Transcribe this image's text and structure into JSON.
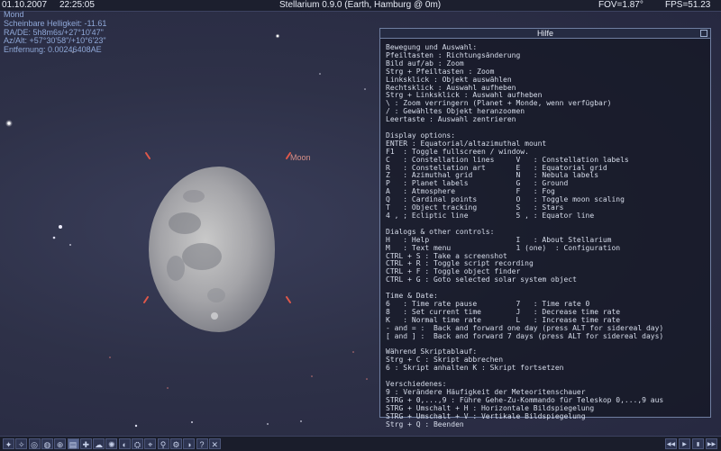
{
  "topbar": {
    "date": "01.10.2007",
    "time": "22:25:05",
    "title": "Stellarium 0.9.0 (Earth, Hamburg @ 0m)",
    "fov": "FOV=1.87°",
    "fps": "FPS=51.23"
  },
  "object_info": {
    "name": "Mond",
    "brightness": "Scheinbare Helligkeit: -11.61",
    "radec": "RA/DE:  5h8m6s/+27°10'47\"",
    "azalt": "Az/Alt: +57°30'58\"/+10°6'23\"",
    "distance": "Entfernung: 0.00246408AE"
  },
  "sky": {
    "moon_label": "Moon"
  },
  "help": {
    "title": "Hilfe",
    "lines": [
      "Bewegung und Auswahl:",
      "Pfeiltasten : Richtungsänderung",
      "Bild auf/ab : Zoom",
      "Strg + Pfeiltasten : Zoom",
      "Linksklick : Objekt auswählen",
      "Rechtsklick : Auswahl aufheben",
      "Strg + Linksklick : Auswahl aufheben",
      "\\ : Zoom verringern (Planet + Monde, wenn verfügbar)",
      "/ : Gewähltes Objekt heranzoomen",
      "Leertaste : Auswahl zentrieren",
      "",
      "Display options:",
      "ENTER : Equatorial/altazimuthal mount",
      "F1  : Toggle fullscreen / window.",
      "C   : Constellation lines     V   : Constellation labels",
      "R   : Constellation art       E   : Equatorial grid",
      "Z   : Azimuthal grid          N   : Nebula labels",
      "P   : Planet labels           G   : Ground",
      "A   : Atmosphere              F   : Fog",
      "Q   : Cardinal points         O   : Toggle moon scaling",
      "T   : Object tracking         S   : Stars",
      "4 , ; Ecliptic line           5 , : Equator line",
      "",
      "Dialogs & other controls:",
      "H   : Help                    I   : About Stellarium",
      "M   : Text menu               1 (one)  : Configuration",
      "CTRL + S : Take a screenshot",
      "CTRL + R : Toggle script recording",
      "CTRL + F : Toggle object finder",
      "CTRL + G : Goto selected solar system object",
      "",
      "Time & Date:",
      "6   : Time rate pause         7   : Time rate 0",
      "8   : Set current time        J   : Decrease time rate",
      "K   : Normal time rate        L   : Increase time rate",
      "- and = :  Back and forward one day (press ALT for sidereal day)",
      "[ and ] :  Back and forward 7 days (press ALT for sidereal days)",
      "",
      "Während Skriptablauf:",
      "Strg + C : Skript abbrechen",
      "6 : Skript anhalten K : Skript fortsetzen",
      "",
      "Verschiedenes:",
      "9 : Verändere Häufigkeit der Meteoritenschauer",
      "STRG + 0,...,9 : Führe Gehe-Zu-Kommando für Teleskop 0,...,9 aus",
      "STRG + Umschalt + H : Horizontale Bildspiegelung",
      "STRG + Umschalt + V : Vertikale Bildspiegelung",
      "Strg + Q : Beenden"
    ]
  },
  "toolbar": {
    "left_buttons": [
      {
        "name": "constellation-lines-icon",
        "glyph": "✦"
      },
      {
        "name": "constellation-labels-icon",
        "glyph": "✧"
      },
      {
        "name": "constellation-art-icon",
        "glyph": "◎"
      },
      {
        "name": "azimuthal-grid-icon",
        "glyph": "◍"
      },
      {
        "name": "equatorial-grid-icon",
        "glyph": "⊕"
      },
      {
        "name": "ground-icon",
        "glyph": "▤"
      },
      {
        "name": "cardinal-points-icon",
        "glyph": "✚"
      },
      {
        "name": "atmosphere-icon",
        "glyph": "☁"
      },
      {
        "name": "nebula-icon",
        "glyph": "✺"
      },
      {
        "name": "planet-labels-icon",
        "glyph": "◐"
      },
      {
        "name": "equatorial-mount-icon",
        "glyph": "⛭"
      },
      {
        "name": "center-selection-icon",
        "glyph": "⌖"
      },
      {
        "name": "search-icon",
        "glyph": "⚲"
      },
      {
        "name": "configuration-icon",
        "glyph": "⚙"
      },
      {
        "name": "night-mode-icon",
        "glyph": "◑"
      },
      {
        "name": "help-icon",
        "glyph": "?"
      },
      {
        "name": "quit-icon",
        "glyph": "✕"
      }
    ],
    "right_buttons": [
      {
        "name": "time-rewind-icon",
        "glyph": "◀◀"
      },
      {
        "name": "time-normal-icon",
        "glyph": "▶"
      },
      {
        "name": "time-now-icon",
        "glyph": "▮"
      },
      {
        "name": "time-forward-icon",
        "glyph": "▶▶"
      }
    ]
  }
}
